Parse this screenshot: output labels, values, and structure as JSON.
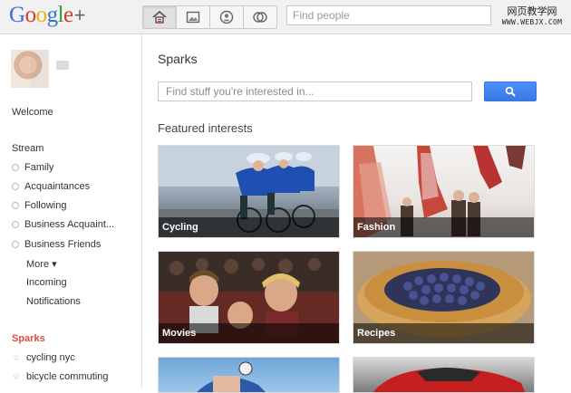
{
  "header": {
    "logo": {
      "g1": "G",
      "o1": "o",
      "o2": "o",
      "g2": "g",
      "l": "l",
      "e": "e",
      "plus": "+"
    },
    "nav": [
      "home-icon",
      "photos-icon",
      "profile-icon",
      "circles-icon"
    ],
    "search_placeholder": "Find people",
    "watermark_cn": "网页教学网",
    "watermark_url": "WWW.WEBJX.COM"
  },
  "sidebar": {
    "welcome": "Welcome",
    "stream": "Stream",
    "circles": [
      "Family",
      "Acquaintances",
      "Following",
      "Business Acquaint...",
      "Business Friends"
    ],
    "more": "More ▾",
    "incoming": "Incoming",
    "notifications": "Notifications",
    "sparks": "Sparks",
    "sparks_items": [
      "cycling nyc",
      "bicycle commuting"
    ]
  },
  "main": {
    "title": "Sparks",
    "search_placeholder": "Find stuff you're interested in...",
    "featured": "Featured interests",
    "interests": [
      "Cycling",
      "Fashion",
      "Movies",
      "Recipes"
    ]
  },
  "colors": {
    "accent": "#4d90fe",
    "sparks_red": "#dd4b39"
  }
}
